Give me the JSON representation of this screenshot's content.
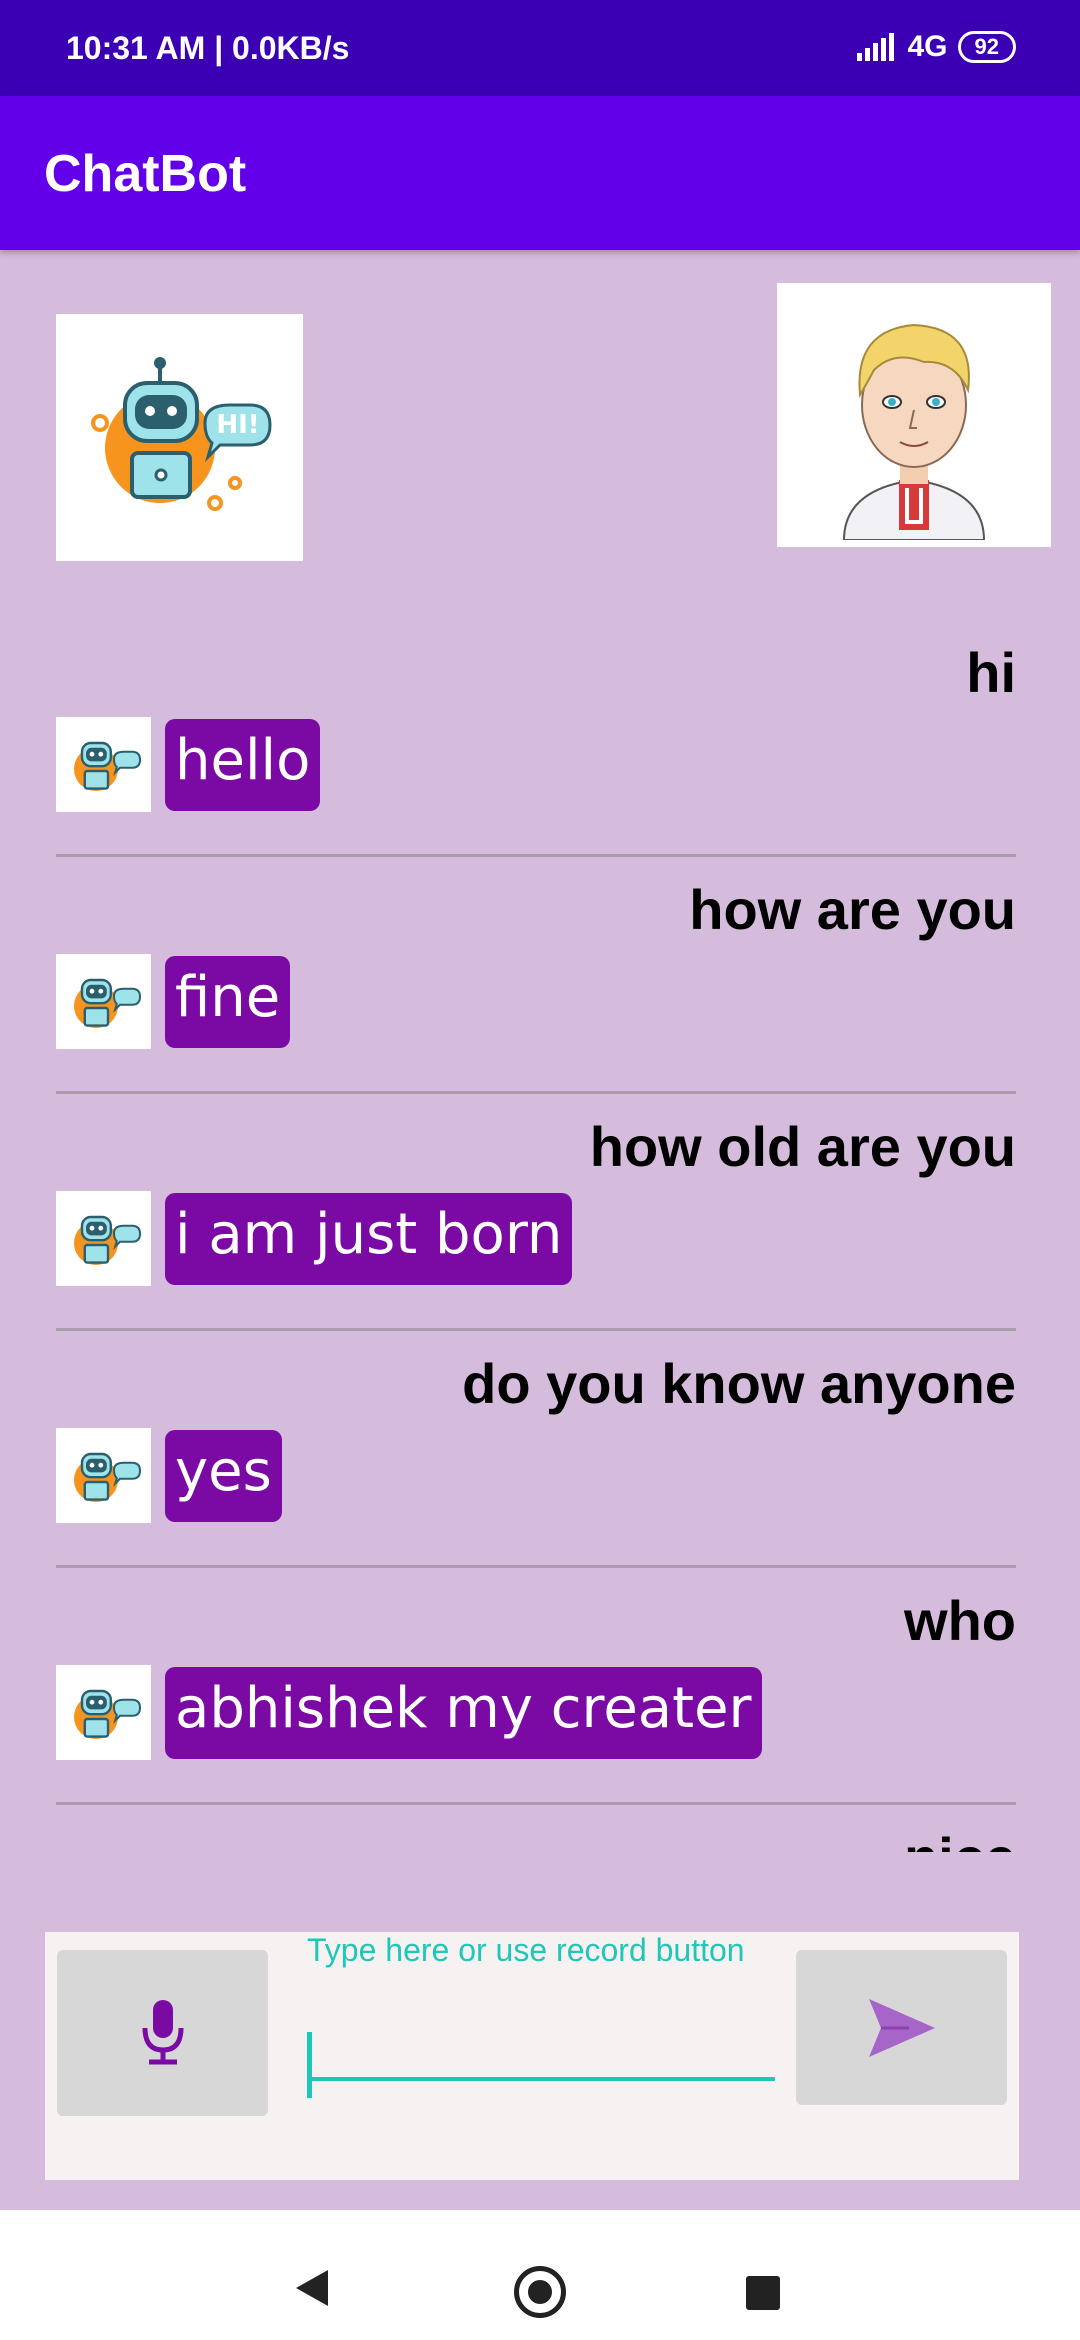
{
  "status_bar": {
    "time": "10:31 AM | 0.0KB/s",
    "network": "4G",
    "battery": "92"
  },
  "app_bar": {
    "title": "ChatBot"
  },
  "conversation": [
    {
      "user": "hi",
      "bot": "hello"
    },
    {
      "user": "how are you",
      "bot": "fine"
    },
    {
      "user": "how old are you",
      "bot": "i am just born"
    },
    {
      "user": "do you know anyone",
      "bot": "yes"
    },
    {
      "user": "who",
      "bot": "abhishek my creater"
    },
    {
      "user": "nice",
      "bot": ""
    }
  ],
  "input": {
    "hint": "Type here or use record button",
    "value": ""
  },
  "colors": {
    "accent": "#6200ea",
    "bubble": "#7b0aa5",
    "background": "#d6bcdc",
    "teal": "#1fc7b8"
  },
  "icons": {
    "mic": "microphone-icon",
    "send": "send-icon",
    "bot": "robot-icon",
    "user": "user-avatar-icon"
  }
}
